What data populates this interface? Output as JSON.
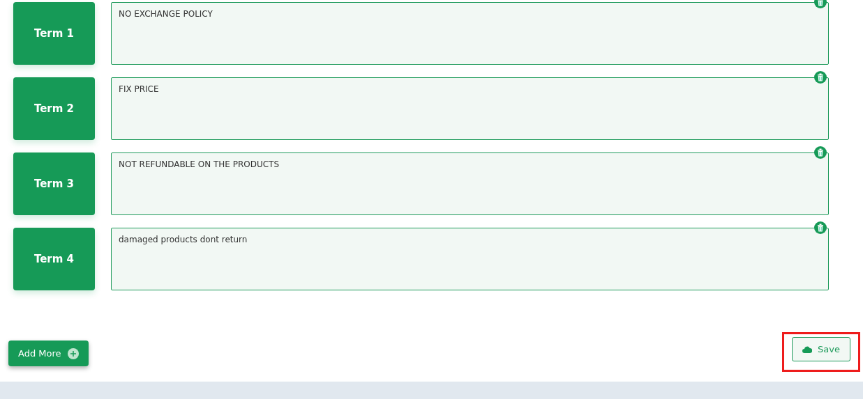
{
  "terms": [
    {
      "label": "Term 1",
      "text": "NO EXCHANGE POLICY"
    },
    {
      "label": "Term 2",
      "text": "FIX PRICE"
    },
    {
      "label": "Term 3",
      "text": "NOT REFUNDABLE ON THE PRODUCTS"
    },
    {
      "label": "Term 4",
      "text": "damaged products dont return"
    }
  ],
  "add_button": {
    "label": "Add More"
  },
  "save_button": {
    "label": "Save",
    "highlighted": true
  }
}
